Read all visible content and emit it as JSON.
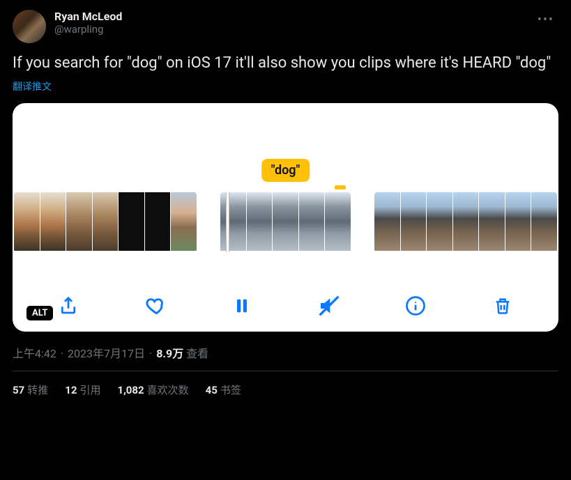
{
  "author": {
    "display_name": "Ryan McLeod",
    "handle": "@warpling"
  },
  "tweet_text": "If you search for \"dog\" on iOS 17 it'll also show you clips where it's HEARD \"dog\"",
  "translate_label": "翻译推文",
  "media": {
    "tooltip": "\"dog\"",
    "alt_badge": "ALT"
  },
  "meta": {
    "time": "上午4:42",
    "dot1": "·",
    "date": "2023年7月17日",
    "dot2": "·",
    "views_count": "8.9万",
    "views_label": "查看"
  },
  "stats": {
    "retweets_count": "57",
    "retweets_label": "转推",
    "quotes_count": "12",
    "quotes_label": "引用",
    "likes_count": "1,082",
    "likes_label": "喜欢次数",
    "bookmarks_count": "45",
    "bookmarks_label": "书签"
  }
}
